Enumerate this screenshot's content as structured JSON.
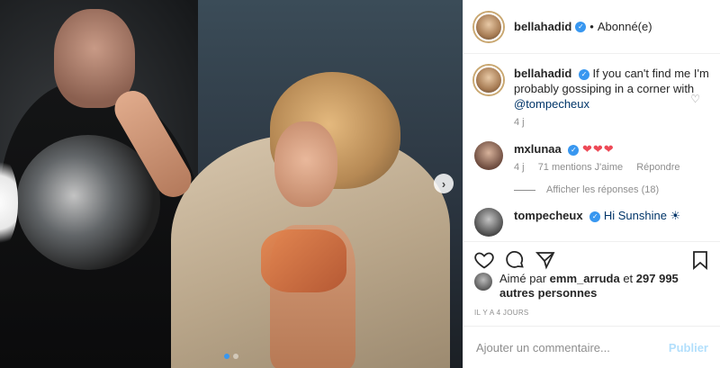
{
  "post": {
    "username": "bellahadid",
    "follow_separator": "•",
    "follow_status": "Abonné(e)",
    "caption": {
      "username": "bellahadid",
      "text": "If you can't find me I'm probably gossiping in a corner with",
      "mention": "@tompecheux",
      "time": "4 j"
    },
    "comments": [
      {
        "username": "mxlunaa",
        "text": "❤❤❤",
        "time": "4 j",
        "likes": "71 mentions J'aime",
        "reply": "Répondre",
        "show_replies": "Afficher les réponses (18)"
      },
      {
        "username": "tompecheux",
        "text": "Hi Sunshine ☀"
      }
    ],
    "liked_by": {
      "prefix": "Aimé par",
      "user": "emm_arruda",
      "joiner": "et",
      "others": "297 995 autres personnes"
    },
    "timestamp": "IL Y A 4 JOURS",
    "comment_placeholder": "Ajouter un commentaire...",
    "publish_label": "Publier",
    "next_arrow": "›"
  },
  "icons": {
    "verified": "✓",
    "comment_like": "♡"
  },
  "colors": {
    "accent": "#3897f0",
    "publish_disabled": "#b2dffc",
    "heart": "#ed4956"
  }
}
